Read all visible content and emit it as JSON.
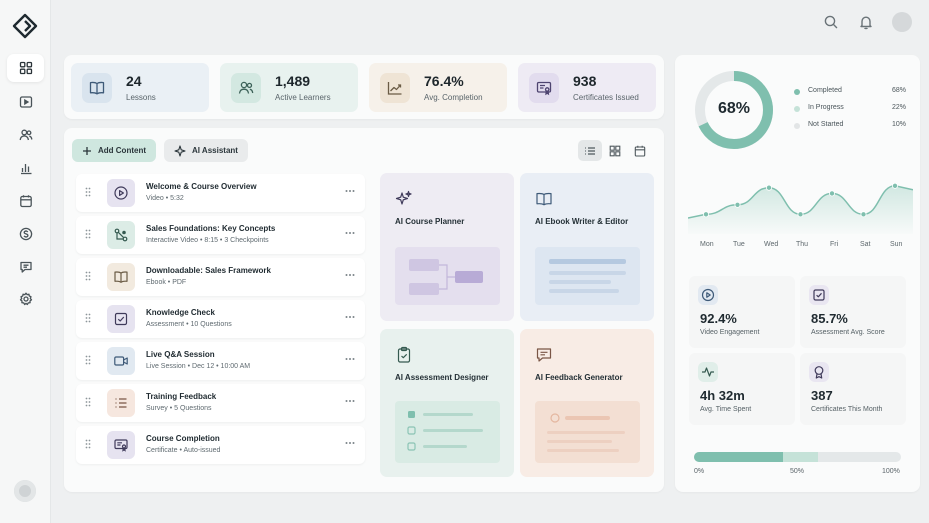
{
  "colors": {
    "accent": "#7fbfae",
    "accent_light": "#cfe7df",
    "track": "#e4e8e9"
  },
  "sidebar": {
    "logo_icon": "diamond-logo-icon",
    "items": [
      {
        "icon": "grid-icon",
        "active": true
      },
      {
        "icon": "video-icon"
      },
      {
        "icon": "users-icon"
      },
      {
        "icon": "bar-chart-icon"
      },
      {
        "icon": "calendar-icon"
      },
      {
        "icon": "dollar-icon"
      },
      {
        "icon": "message-icon"
      },
      {
        "icon": "settings-icon"
      }
    ]
  },
  "topbar": {
    "icons": [
      "search-icon",
      "bell-icon",
      "avatar"
    ]
  },
  "stats": [
    {
      "value": "24",
      "label": "Lessons",
      "icon": "book-icon"
    },
    {
      "value": "1,489",
      "label": "Active Learners",
      "icon": "users-icon"
    },
    {
      "value": "76.4%",
      "label": "Avg. Completion",
      "icon": "trend-icon"
    },
    {
      "value": "938",
      "label": "Certificates Issued",
      "icon": "certificate-icon"
    }
  ],
  "toolbar": {
    "add_content": "Add Content",
    "ai_assistant": "AI Assistant"
  },
  "content_items": [
    {
      "title": "Welcome & Course Overview",
      "meta": "Video • 5:32"
    },
    {
      "title": "Sales Foundations: Key Concepts",
      "meta": "Interactive Video • 8:15 • 3 Checkpoints"
    },
    {
      "title": "Downloadable: Sales Framework",
      "meta": "Ebook • PDF"
    },
    {
      "title": "Knowledge Check",
      "meta": "Assessment • 10 Questions"
    },
    {
      "title": "Live Q&A Session",
      "meta": "Live Session • Dec 12 • 10:00 AM"
    },
    {
      "title": "Training Feedback",
      "meta": "Survey • 5 Questions"
    },
    {
      "title": "Course Completion",
      "meta": "Certificate • Auto-issued"
    }
  ],
  "ai_tools": [
    {
      "label": "AI Course Planner"
    },
    {
      "label": "AI Ebook Writer & Editor"
    },
    {
      "label": "AI Assessment Designer"
    },
    {
      "label": "AI Feedback Generator"
    }
  ],
  "completion": {
    "center_label": "68%",
    "legend": [
      {
        "name": "Completed",
        "value": "68%",
        "color": "#7fbfae"
      },
      {
        "name": "In Progress",
        "value": "22%",
        "color": "#c5e2d8"
      },
      {
        "name": "Not Started",
        "value": "10%",
        "color": "#e2e5e6"
      }
    ]
  },
  "chart_data": {
    "type": "area",
    "categories": [
      "Mon",
      "Tue",
      "Wed",
      "Thu",
      "Fri",
      "Sat",
      "Sun"
    ],
    "values": [
      0.15,
      0.4,
      0.85,
      0.15,
      0.7,
      0.15,
      0.9
    ]
  },
  "metrics": [
    {
      "value": "92.4%",
      "label": "Video Engagement",
      "icon": "play-circle-icon"
    },
    {
      "value": "85.7%",
      "label": "Assessment Avg. Score",
      "icon": "check-square-icon"
    },
    {
      "value": "4h 32m",
      "label": "Avg. Time Spent",
      "icon": "activity-icon"
    },
    {
      "value": "387",
      "label": "Certificates This Month",
      "icon": "award-icon"
    }
  ],
  "progress": {
    "ticks": [
      "0%",
      "50%",
      "100%"
    ],
    "completed": 0.43,
    "in_progress": 0.17
  }
}
